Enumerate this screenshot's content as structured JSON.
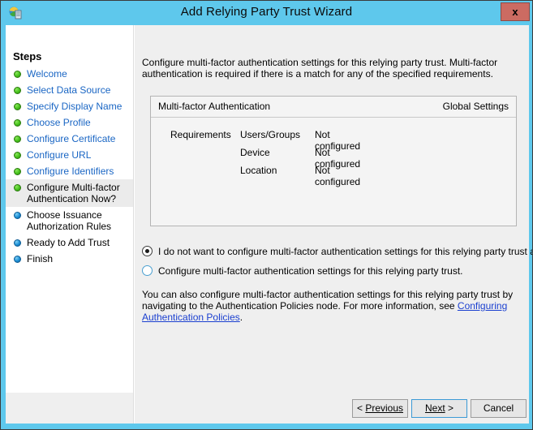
{
  "window": {
    "title": "Add Relying Party Trust Wizard",
    "icon": "adfs-wizard-icon",
    "close_label": "x",
    "titlebar_color": "#5ec8ec",
    "close_color": "#cc6b62"
  },
  "sidebar": {
    "heading": "Steps",
    "items": [
      {
        "label": "Welcome",
        "state": "done"
      },
      {
        "label": "Select Data Source",
        "state": "done"
      },
      {
        "label": "Specify Display Name",
        "state": "done"
      },
      {
        "label": "Choose Profile",
        "state": "done"
      },
      {
        "label": "Configure Certificate",
        "state": "done"
      },
      {
        "label": "Configure URL",
        "state": "done"
      },
      {
        "label": "Configure Identifiers",
        "state": "done"
      },
      {
        "label": "Configure Multi-factor Authentication Now?",
        "state": "current"
      },
      {
        "label": "Choose Issuance Authorization Rules",
        "state": "pending"
      },
      {
        "label": "Ready to Add Trust",
        "state": "pending"
      },
      {
        "label": "Finish",
        "state": "pending"
      }
    ]
  },
  "main": {
    "intro": "Configure multi-factor authentication settings for this relying party trust. Multi-factor authentication is required if there is a match for any of the specified requirements.",
    "mfa_panel": {
      "header_left": "Multi-factor Authentication",
      "header_right": "Global Settings",
      "requirements_label": "Requirements",
      "rows": [
        {
          "name": "Users/Groups",
          "value": "Not configured"
        },
        {
          "name": "Device",
          "value": "Not configured"
        },
        {
          "name": "Location",
          "value": "Not configured"
        }
      ]
    },
    "options": [
      {
        "label": "I do not want to configure multi-factor authentication settings for this relying party trust at this",
        "selected": true
      },
      {
        "label": "Configure multi-factor authentication settings for this relying party trust.",
        "selected": false
      }
    ],
    "note": {
      "text_before": "You can also configure multi-factor authentication settings for this relying party trust by navigating to the Authentication Policies node. For more information, see ",
      "link_text": "Configuring Authentication Policies",
      "text_after": "."
    }
  },
  "footer": {
    "previous": "Previous",
    "next": "Next",
    "cancel": "Cancel"
  }
}
